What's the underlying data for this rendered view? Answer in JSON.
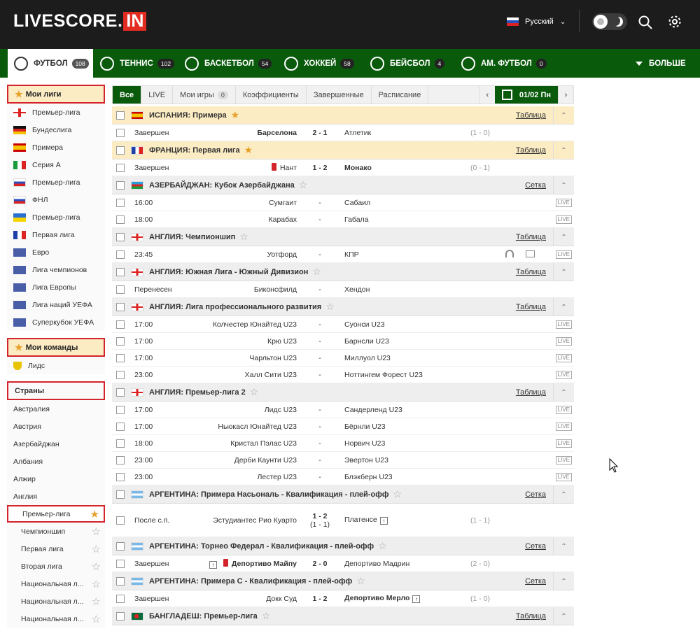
{
  "header": {
    "logo_text": "LIVESCORE.",
    "logo_badge": "IN",
    "language": "Русский"
  },
  "sports": [
    {
      "label": "ФУТБОЛ",
      "count": "108"
    },
    {
      "label": "ТЕННИС",
      "count": "102"
    },
    {
      "label": "БАСКЕТБОЛ",
      "count": "54"
    },
    {
      "label": "ХОККЕЙ",
      "count": "58"
    },
    {
      "label": "БЕЙСБОЛ",
      "count": "4"
    },
    {
      "label": "АМ. ФУТБОЛ",
      "count": "0"
    }
  ],
  "more_label": "БОЛЬШЕ",
  "sidebar": {
    "my_leagues_title": "Мои лиги",
    "my_leagues": [
      "Премьер-лига",
      "Бундеслига",
      "Примера",
      "Серия А",
      "Премьер-лига",
      "ФНЛ",
      "Премьер-лига",
      "Первая лига",
      "Евро",
      "Лига чемпионов",
      "Лига Европы",
      "Лига наций УЕФА",
      "Суперкубок УЕФА"
    ],
    "my_teams_title": "Мои команды",
    "my_teams": [
      "Лидс"
    ],
    "countries_title": "Страны",
    "countries": [
      "Австралия",
      "Австрия",
      "Азербайджан",
      "Албания",
      "Алжир",
      "Англия"
    ],
    "england_leagues": [
      "Премьер-лига",
      "Чемпионшип",
      "Первая лига",
      "Вторая лига",
      "Национальная л...",
      "Национальная л...",
      "Национальная л..."
    ]
  },
  "filter_tabs": {
    "all": "Все",
    "live": "LIVE",
    "my_games": "Мои игры",
    "my_games_count": "0",
    "odds": "Коэффициенты",
    "finished": "Завершенные",
    "schedule": "Расписание",
    "date": "01/02 Пн"
  },
  "live_badge": "LIVE",
  "leagues": [
    {
      "name": "ИСПАНИЯ: Примера",
      "link": "Таблица",
      "matches": [
        {
          "status": "Завершен",
          "home": "Барселона",
          "score": "2 - 1",
          "away": "Атлетик",
          "ht": "(1 - 0)"
        }
      ]
    },
    {
      "name": "ФРАНЦИЯ: Первая лига",
      "link": "Таблица",
      "matches": [
        {
          "status": "Завершен",
          "home": "Нант",
          "score": "1 - 2",
          "away": "Монако",
          "ht": "(0 - 1)"
        }
      ]
    },
    {
      "name": "АЗЕРБАЙДЖАН: Кубок Азербайджана",
      "link": "Сетка",
      "matches": [
        {
          "status": "16:00",
          "home": "Сумгаит",
          "score": "-",
          "away": "Сабаил"
        },
        {
          "status": "18:00",
          "home": "Карабах",
          "score": "-",
          "away": "Габала"
        }
      ]
    },
    {
      "name": "АНГЛИЯ: Чемпионшип",
      "link": "Таблица",
      "matches": [
        {
          "status": "23:45",
          "home": "Уотфорд",
          "score": "-",
          "away": "КПР"
        }
      ]
    },
    {
      "name": "АНГЛИЯ: Южная Лига - Южный Дивизион",
      "link": "Таблица",
      "matches": [
        {
          "status": "Перенесен",
          "home": "Биконсфилд",
          "score": "-",
          "away": "Хендон"
        }
      ]
    },
    {
      "name": "АНГЛИЯ: Лига профессионального развития",
      "link": "Таблица",
      "matches": [
        {
          "status": "17:00",
          "home": "Колчестер Юнайтед U23",
          "score": "-",
          "away": "Суонси U23"
        },
        {
          "status": "17:00",
          "home": "Крю U23",
          "score": "-",
          "away": "Барнсли U23"
        },
        {
          "status": "17:00",
          "home": "Чарльтон U23",
          "score": "-",
          "away": "Миллуол U23"
        },
        {
          "status": "23:00",
          "home": "Халл Сити U23",
          "score": "-",
          "away": "Ноттингем Форест U23"
        }
      ]
    },
    {
      "name": "АНГЛИЯ: Премьер-лига 2",
      "link": "Таблица",
      "matches": [
        {
          "status": "17:00",
          "home": "Лидс U23",
          "score": "-",
          "away": "Сандерленд U23"
        },
        {
          "status": "17:00",
          "home": "Ньюкасл Юнайтед U23",
          "score": "-",
          "away": "Бёрнли U23"
        },
        {
          "status": "18:00",
          "home": "Кристал Пэлас U23",
          "score": "-",
          "away": "Норвич U23"
        },
        {
          "status": "23:00",
          "home": "Дерби Каунти U23",
          "score": "-",
          "away": "Эвертон U23"
        },
        {
          "status": "23:00",
          "home": "Лестер U23",
          "score": "-",
          "away": "Блэкберн U23"
        }
      ]
    },
    {
      "name": "АРГЕНТИНА: Примера Насьональ - Квалификация - плей-офф",
      "link": "Сетка",
      "matches": [
        {
          "status": "После с.п.",
          "home": "Эстудиантес Рио Куарто",
          "score": "1 - 2",
          "score2": "(1 - 1)",
          "away": "Платенсе",
          "ht": "(1 - 1)"
        }
      ]
    },
    {
      "name": "АРГЕНТИНА: Торнео Федерал - Квалификация - плей-офф",
      "link": "Сетка",
      "matches": [
        {
          "status": "Завершен",
          "home": "Депортиво Майпу",
          "score": "2 - 0",
          "away": "Депортиво Мадрин",
          "ht": "(2 - 0)"
        }
      ]
    },
    {
      "name": "АРГЕНТИНА: Примера С - Квалификация - плей-офф",
      "link": "Сетка",
      "matches": [
        {
          "status": "Завершен",
          "home": "Докк Суд",
          "score": "1 - 2",
          "away": "Депортиво Мерло",
          "ht": "(1 - 0)"
        }
      ]
    },
    {
      "name": "БАНГЛАДЕШ: Премьер-лига",
      "link": "Таблица",
      "matches": []
    }
  ],
  "colors": {
    "header_bg": "#1c1c1c",
    "sport_bar": "#0a5a0c",
    "accent_red": "#e22b21",
    "favorite": "#fcecc4",
    "star": "#e7a12b"
  }
}
